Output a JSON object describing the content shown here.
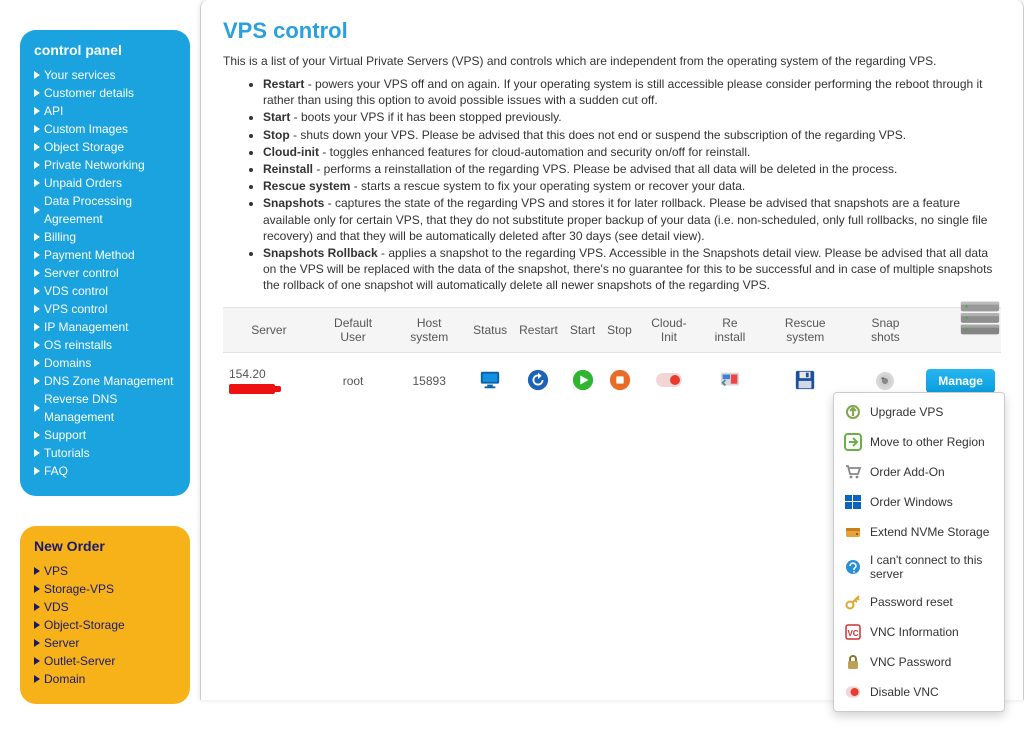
{
  "sidebar": {
    "control_panel": {
      "title": "control panel",
      "items": [
        "Your services",
        "Customer details",
        "API",
        "Custom Images",
        "Object Storage",
        "Private Networking",
        "Unpaid Orders",
        "Data Processing Agreement",
        "Billing",
        "Payment Method",
        "Server control",
        "VDS control",
        "VPS control",
        "IP Management",
        "OS reinstalls",
        "Domains",
        "DNS Zone Management",
        "Reverse DNS Management",
        "Support",
        "Tutorials",
        "FAQ"
      ]
    },
    "new_order": {
      "title": "New Order",
      "items": [
        "VPS",
        "Storage-VPS",
        "VDS",
        "Object-Storage",
        "Server",
        "Outlet-Server",
        "Domain"
      ]
    }
  },
  "page": {
    "title": "VPS control",
    "intro": "This is a list of your Virtual Private Servers (VPS) and controls which are independent from the operating system of the regarding VPS.",
    "bullets": [
      {
        "b": "Restart",
        "t": " - powers your VPS off and on again. If your operating system is still accessible please consider performing the reboot through it rather than using this option to avoid possible issues with a sudden cut off."
      },
      {
        "b": "Start",
        "t": " - boots your VPS if it has been stopped previously."
      },
      {
        "b": "Stop",
        "t": " - shuts down your VPS. Please be advised that this does not end or suspend the subscription of the regarding VPS."
      },
      {
        "b": "Cloud-init",
        "t": " - toggles enhanced features for cloud-automation and security on/off for reinstall."
      },
      {
        "b": "Reinstall",
        "t": " - performs a reinstallation of the regarding VPS. Please be advised that all data will be deleted in the process."
      },
      {
        "b": "Rescue system",
        "t": " - starts a rescue system to fix your operating system or recover your data."
      },
      {
        "b": "Snapshots",
        "t": " - captures the state of the regarding VPS and stores it for later rollback. Please be advised that snapshots are a feature available only for certain VPS, that they do not substitute proper backup of your data (i.e. non-scheduled, only full rollbacks, no single file recovery) and that they will be automatically deleted after 30 days (see detail view)."
      },
      {
        "b": "Snapshots Rollback",
        "t": " - applies a snapshot to the regarding VPS. Accessible in the Snapshots detail view. Please be advised that all data on the VPS will be replaced with the data of the snapshot, there's no guarantee for this to be successful and in case of multiple snapshots the rollback of one snapshot will automatically delete all newer snapshots of the regarding VPS."
      }
    ]
  },
  "table": {
    "headers": {
      "server": "Server",
      "default_user": "Default User",
      "host_system": "Host system",
      "status": "Status",
      "restart": "Restart",
      "start": "Start",
      "stop": "Stop",
      "cloud_init": "Cloud-Init",
      "reinstall": "Re install",
      "rescue": "Rescue system",
      "snapshots": "Snap shots",
      "manage": ""
    },
    "row": {
      "server_prefix": "154.20",
      "default_user": "root",
      "host_system": "15893",
      "manage_label": "Manage"
    }
  },
  "dropdown": {
    "items": [
      "Upgrade VPS",
      "Move to other Region",
      "Order Add-On",
      "Order Windows",
      "Extend NVMe Storage",
      "I can't connect to this server",
      "Password reset",
      "VNC Information",
      "VNC Password",
      "Disable VNC"
    ]
  }
}
